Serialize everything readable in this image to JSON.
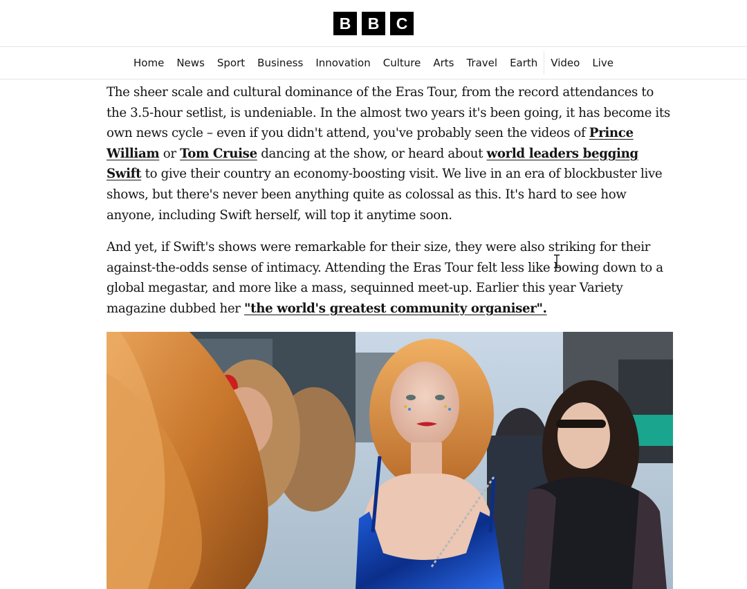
{
  "header": {
    "logo_letters": [
      "B",
      "B",
      "C"
    ]
  },
  "nav": {
    "items": [
      "Home",
      "News",
      "Sport",
      "Business",
      "Innovation",
      "Culture",
      "Arts",
      "Travel",
      "Earth",
      "Video",
      "Live"
    ]
  },
  "article": {
    "p1": {
      "t1": "The sheer scale and cultural dominance of the Eras Tour, from the record attendances to the 3.5-hour setlist, is undeniable. In the almost two years it's been going, it has become its own news cycle – even if you didn't attend, you've probably seen the videos of ",
      "link1": "Prince William",
      "t2": " or ",
      "link2": "Tom Cruise",
      "t3": " dancing at the show, or heard about ",
      "link3": "world leaders begging Swift",
      "t4": " to give their country an economy-boosting visit. We live in an era of blockbuster live shows, but there's never been anything quite as colossal as this. It's hard to see how anyone, including Swift herself, will top it anytime soon."
    },
    "p2": {
      "t1": "And yet, if Swift's shows were remarkable for their size, they were also striking for their against-the-odds sense of intimacy. Attending the Eras Tour felt less like bowing down to a global megastar, and more like a mass, sequinned meet-up. Earlier this year Variety magazine dubbed her ",
      "link1": "\"the world's greatest community organiser\"."
    }
  },
  "colors": {
    "text": "#141414",
    "logo_bg": "#000000",
    "divider": "#e5e5e5"
  }
}
